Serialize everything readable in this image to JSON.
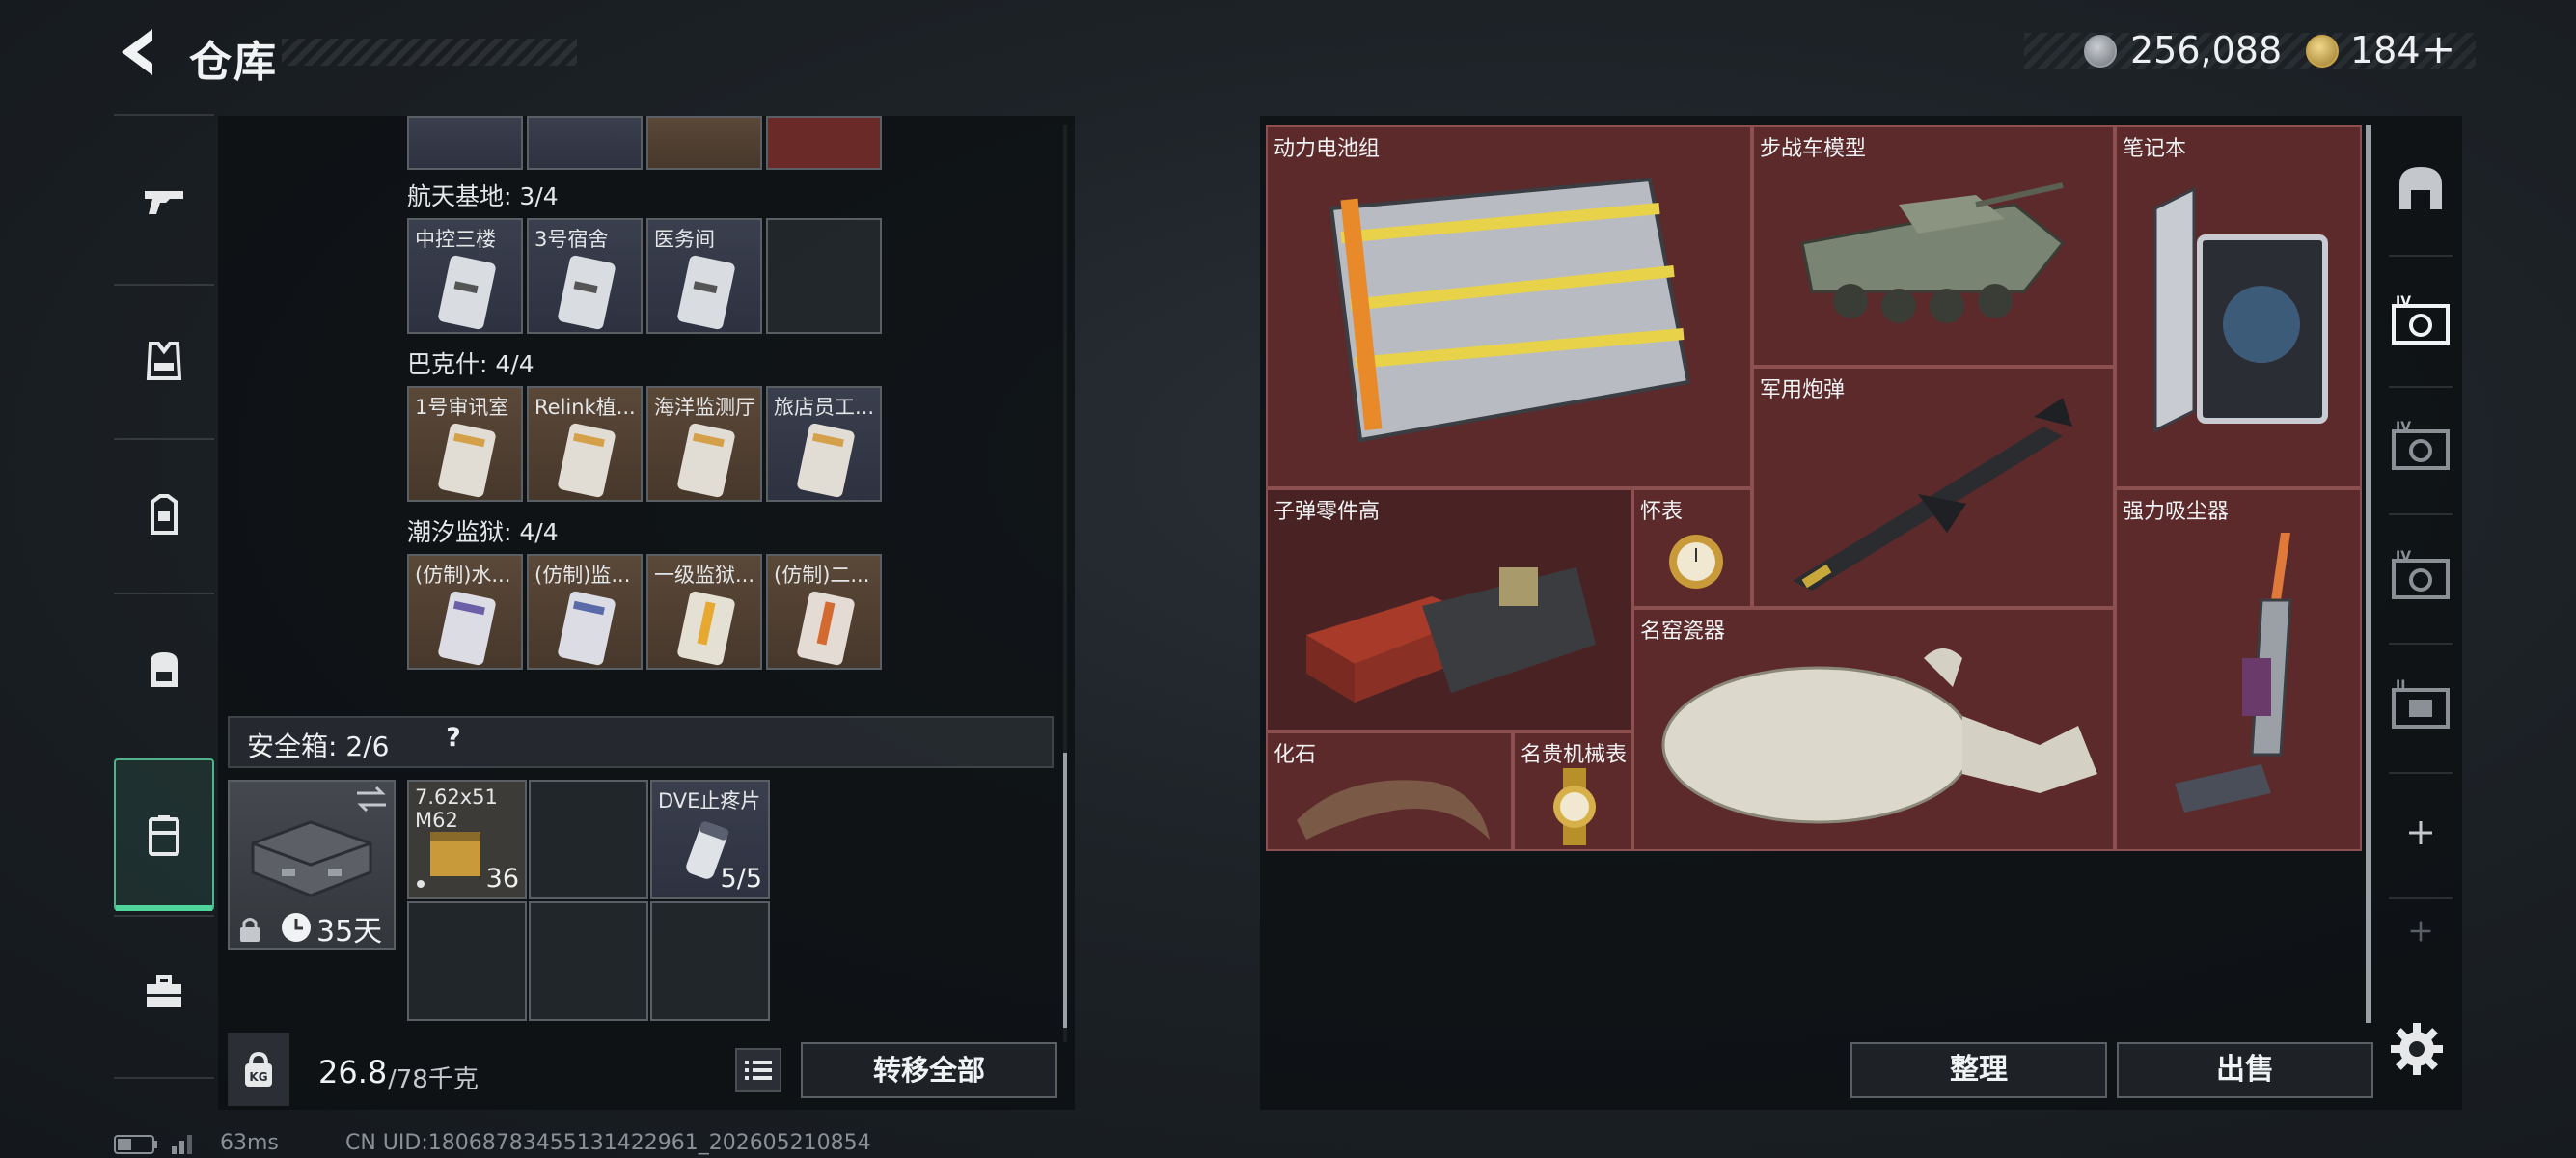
{
  "header": {
    "title": "仓库"
  },
  "currency": {
    "silver": "256,088",
    "gold": "184",
    "plus": "+"
  },
  "left_nav": {
    "items": [
      {
        "icon": "gun-icon"
      },
      {
        "icon": "armor-vest-icon"
      },
      {
        "icon": "chest-rig-icon"
      },
      {
        "icon": "backpack-icon"
      },
      {
        "icon": "safe-case-icon",
        "active": true
      },
      {
        "icon": "toolbox-icon"
      }
    ]
  },
  "inventory": {
    "sections": [
      {
        "title": "航天基地: 3/4",
        "slots": [
          {
            "label": "中控三楼",
            "color": "blue"
          },
          {
            "label": "3号宿舍",
            "color": "blue"
          },
          {
            "label": "医务间",
            "color": "blue"
          },
          {
            "label": "",
            "color": "empty"
          }
        ]
      },
      {
        "title": "巴克什: 4/4",
        "slots": [
          {
            "label": "1号审讯室",
            "color": "brown"
          },
          {
            "label": "Relink植...",
            "color": "brown"
          },
          {
            "label": "海洋监测厅",
            "color": "brown"
          },
          {
            "label": "旅店员工...",
            "color": "blue"
          }
        ]
      },
      {
        "title": "潮汐监狱: 4/4",
        "slots": [
          {
            "label": "(仿制)水...",
            "color": "brown"
          },
          {
            "label": "(仿制)监...",
            "color": "brown"
          },
          {
            "label": "一级监狱...",
            "color": "brown"
          },
          {
            "label": "(仿制)二...",
            "color": "brown"
          }
        ]
      }
    ]
  },
  "safebox": {
    "title": "安全箱: 2/6",
    "help": "?",
    "case_days": "35天",
    "items": [
      {
        "label": "7.62x51 M62",
        "qty": "36"
      },
      {
        "label": "DVE止疼片",
        "qty": "5/5"
      }
    ]
  },
  "weight": {
    "current": "26.8",
    "limit": "/78千克",
    "icon_text": "KG"
  },
  "buttons": {
    "transfer_all": "转移全部",
    "sort": "整理",
    "sell": "出售"
  },
  "loot": {
    "items": [
      {
        "label": "动力电池组"
      },
      {
        "label": "步战车模型"
      },
      {
        "label": "笔记本"
      },
      {
        "label": "军用炮弹"
      },
      {
        "label": "子弹零件高"
      },
      {
        "label": "怀表"
      },
      {
        "label": "强力吸尘器"
      },
      {
        "label": "名窑瓷器"
      },
      {
        "label": "化石"
      },
      {
        "label": "名贵机械表"
      }
    ]
  },
  "status": {
    "ping": "63ms",
    "uid": "CN UID:18068783455131422961_202605210854"
  },
  "colors": {
    "accent": "#4fd49c",
    "loot_bg": "#5c2a2b",
    "slot_blue": "#3a3f4e",
    "slot_brown": "#5a4838"
  }
}
